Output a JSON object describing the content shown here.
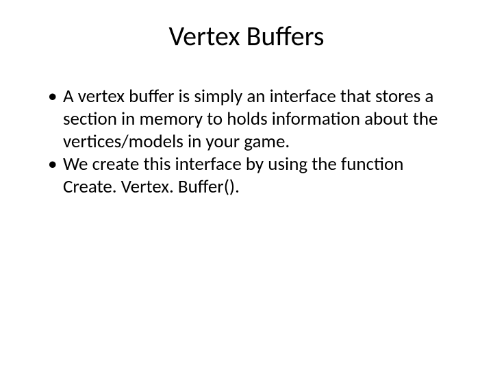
{
  "slide": {
    "title": "Vertex Buffers",
    "bullets": [
      "A vertex buffer is simply an interface that stores a section in memory to holds information about the vertices/models in your game.",
      "We create this interface by using the function Create. Vertex. Buffer()."
    ]
  }
}
